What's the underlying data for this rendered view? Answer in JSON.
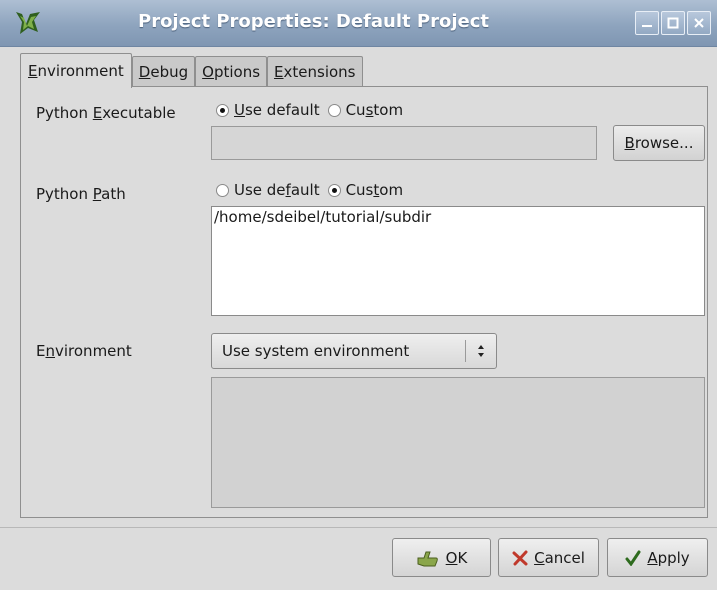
{
  "window": {
    "title": "Project Properties: Default Project"
  },
  "tabs": [
    {
      "label": "Environment",
      "mnemonic_index": 0,
      "active": true
    },
    {
      "label": "Debug",
      "mnemonic_index": 0,
      "active": false
    },
    {
      "label": "Options",
      "mnemonic_index": 0,
      "active": false
    },
    {
      "label": "Extensions",
      "mnemonic_index": 0,
      "active": false
    }
  ],
  "python_executable": {
    "label_pre": "Python ",
    "label_u": "E",
    "label_post": "xecutable",
    "use_default_pre": "",
    "use_default_u": "U",
    "use_default_post": "se default",
    "custom_pre": "Cu",
    "custom_u": "s",
    "custom_post": "tom",
    "selected": "use_default",
    "value": "",
    "browse_u": "B",
    "browse_post": "rowse..."
  },
  "python_path": {
    "label_pre": "Python ",
    "label_u": "P",
    "label_post": "ath",
    "use_default_pre": "Use de",
    "use_default_u": "f",
    "use_default_post": "ault",
    "custom_pre": "Cus",
    "custom_u": "t",
    "custom_post": "om",
    "selected": "custom",
    "value": "/home/sdeibel/tutorial/subdir"
  },
  "environment": {
    "label_pre": "E",
    "label_u": "n",
    "label_post": "vironment",
    "selected_option": "Use system environment"
  },
  "buttons": {
    "ok_u": "O",
    "ok_post": "K",
    "cancel_u": "C",
    "cancel_post": "ancel",
    "apply_u": "A",
    "apply_post": "pply"
  },
  "colors": {
    "titlebar": "#8ea4be",
    "cancel_icon": "#c0392b",
    "ok_icon": "#5a7a2a",
    "apply_icon": "#2e6b1e"
  }
}
